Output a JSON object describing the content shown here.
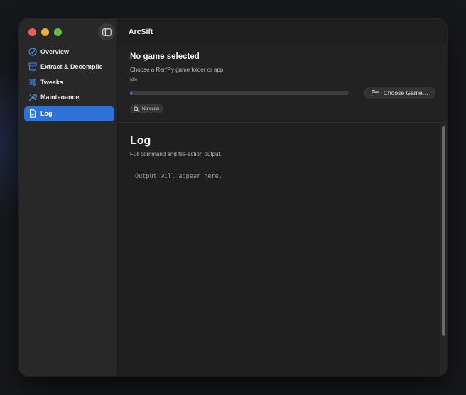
{
  "window": {
    "title": "ArcSift"
  },
  "sidebar": {
    "items": [
      {
        "label": "Overview",
        "icon": "gauge-icon",
        "active": false
      },
      {
        "label": "Extract & Decompile",
        "icon": "archive-box-icon",
        "active": false
      },
      {
        "label": "Tweaks",
        "icon": "sliders-icon",
        "active": false
      },
      {
        "label": "Maintenance",
        "icon": "wrench-screwdriver-icon",
        "active": false
      },
      {
        "label": "Log",
        "icon": "document-icon",
        "active": true
      }
    ]
  },
  "status": {
    "title": "No game selected",
    "subtitle": "Choose a Ren'Py game folder or app.",
    "state": "Idle",
    "progress": 0.01,
    "choose_button": "Choose Game…",
    "scan_badge": "No scan"
  },
  "log": {
    "title": "Log",
    "subtitle": "Full command and file-action output.",
    "placeholder": "Output will appear here."
  },
  "colors": {
    "accent": "#2f73d9",
    "close": "#ec5f57",
    "minimize": "#e3b23c",
    "zoom": "#5dc143"
  }
}
